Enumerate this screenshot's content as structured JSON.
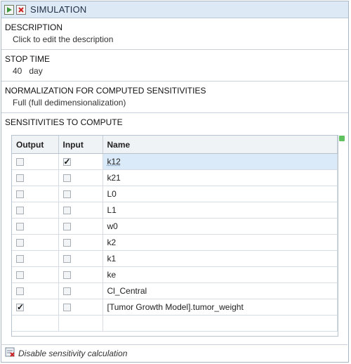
{
  "title": "SIMULATION",
  "description": {
    "header": "DESCRIPTION",
    "value": "Click to edit the description"
  },
  "stop_time": {
    "header": "STOP TIME",
    "value": "40",
    "unit": "day"
  },
  "normalization": {
    "header": "NORMALIZATION FOR COMPUTED SENSITIVITIES",
    "value": "Full (full dedimensionalization)"
  },
  "sensitivities": {
    "header": "SENSITIVITIES TO COMPUTE",
    "columns": [
      "Output",
      "Input",
      "Name"
    ],
    "rows": [
      {
        "output": false,
        "input": true,
        "name": "k12"
      },
      {
        "output": false,
        "input": false,
        "name": "k21"
      },
      {
        "output": false,
        "input": false,
        "name": "L0"
      },
      {
        "output": false,
        "input": false,
        "name": "L1"
      },
      {
        "output": false,
        "input": false,
        "name": "w0"
      },
      {
        "output": false,
        "input": false,
        "name": "k2"
      },
      {
        "output": false,
        "input": false,
        "name": "k1"
      },
      {
        "output": false,
        "input": false,
        "name": "ke"
      },
      {
        "output": false,
        "input": false,
        "name": "Cl_Central"
      },
      {
        "output": true,
        "input": false,
        "name": "[Tumor Growth Model].tumor_weight"
      }
    ]
  },
  "footer": {
    "label": "Disable sensitivity calculation"
  },
  "colors": {
    "titlebar": "#dde9f5",
    "selected": "#dbeaf8",
    "status": "#5fc25f"
  },
  "icons": {
    "run": "run-simulation-icon",
    "delete": "delete-icon",
    "footer": "sensitivity-toggle-icon"
  }
}
